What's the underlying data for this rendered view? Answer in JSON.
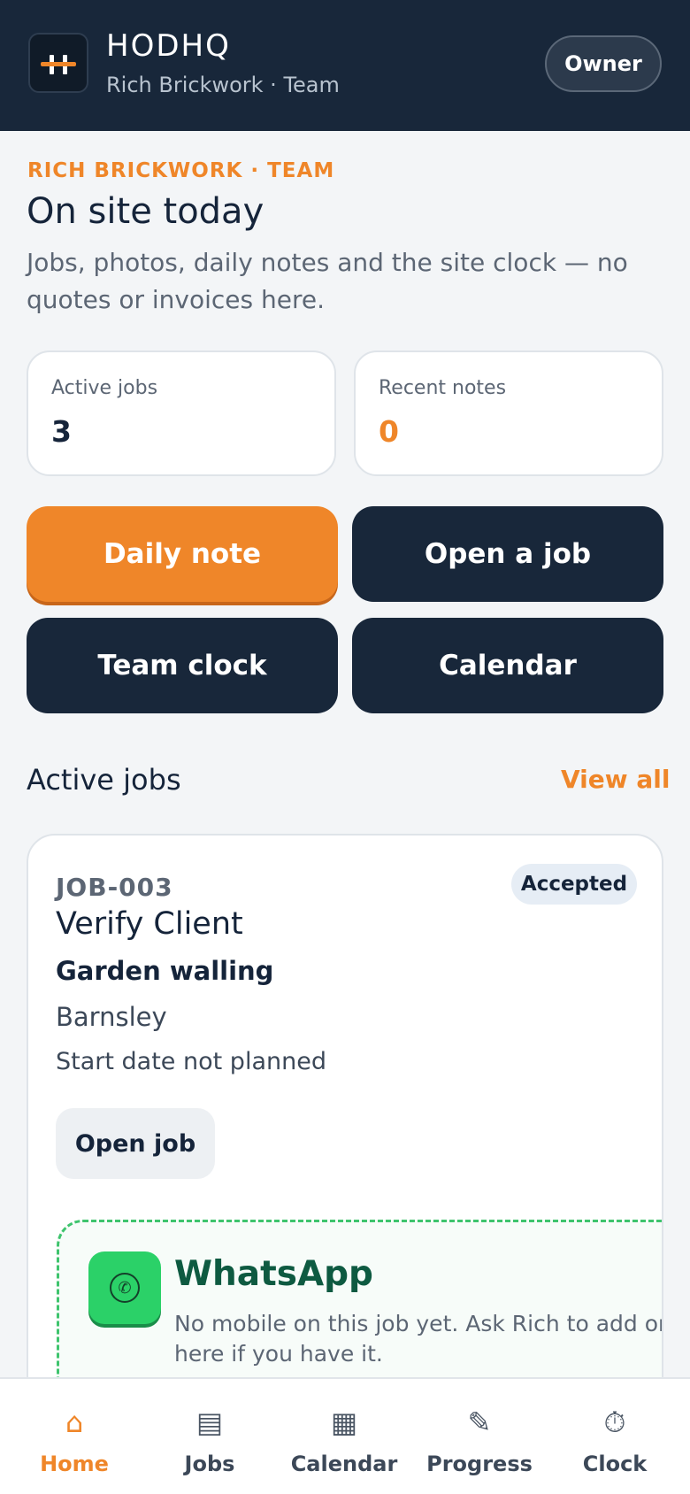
{
  "header": {
    "app_name": "HODHQ",
    "subtitle": "Rich Brickwork · Team",
    "role_button": "Owner"
  },
  "intro": {
    "eyebrow": "RICH BRICKWORK · TEAM",
    "title": "On site today",
    "description": "Jobs, photos, daily notes and the site clock — no quotes or invoices here."
  },
  "stats": [
    {
      "label": "Active jobs",
      "value": "3"
    },
    {
      "label": "Recent notes",
      "value": "0"
    }
  ],
  "actions": [
    "Daily note",
    "Open a job",
    "Team clock",
    "Calendar"
  ],
  "active_jobs": {
    "title": "Active jobs",
    "view_all": "View all"
  },
  "job": {
    "id": "JOB-003",
    "status": "Accepted",
    "client": "Verify Client",
    "type": "Garden walling",
    "location": "Barnsley",
    "start": "Start date not planned",
    "open_label": "Open job"
  },
  "whatsapp": {
    "title": "WhatsApp",
    "text": "No mobile on this job yet. Ask Rich to add one here if you have it.",
    "icon": "phone-icon"
  },
  "nav": [
    {
      "label": "Home",
      "icon": "⌂",
      "icon_name": "home-icon",
      "active": true
    },
    {
      "label": "Jobs",
      "icon": "▤",
      "icon_name": "jobs-icon",
      "active": false
    },
    {
      "label": "Calendar",
      "icon": "▦",
      "icon_name": "calendar-icon",
      "active": false
    },
    {
      "label": "Progress",
      "icon": "✎",
      "icon_name": "pencil-icon",
      "active": false
    },
    {
      "label": "Clock",
      "icon": "⏱",
      "icon_name": "stopwatch-icon",
      "active": false
    }
  ],
  "colors": {
    "accent": "#ef8629",
    "navy": "#18273a",
    "whatsapp_green": "#2bd168"
  }
}
